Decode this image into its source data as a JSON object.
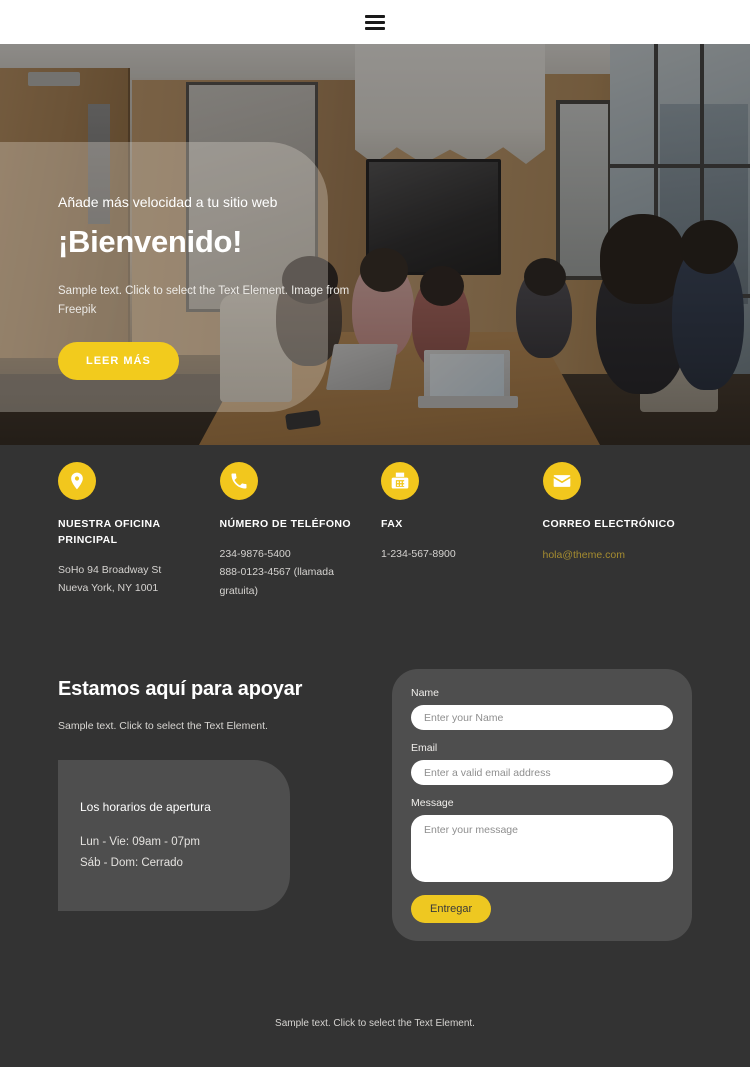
{
  "header": {
    "menu_icon": "hamburger-icon"
  },
  "hero": {
    "kicker": "Añade más velocidad a tu sitio web",
    "title": "¡Bienvenido!",
    "subtitle": "Sample text. Click to select the Text Element. Image from Freepik",
    "cta_label": "LEER MÁS",
    "accent_color": "#f2cb1d"
  },
  "contact": {
    "items": [
      {
        "icon": "location-pin-icon",
        "title": "NUESTRA OFICINA PRINCIPAL",
        "lines": [
          "SoHo 94 Broadway St",
          "Nueva York, NY 1001"
        ],
        "link": ""
      },
      {
        "icon": "phone-icon",
        "title": "NÚMERO DE TELÉFONO",
        "lines": [
          "234-9876-5400",
          "888-0123-4567 (llamada gratuita)"
        ],
        "link": ""
      },
      {
        "icon": "fax-icon",
        "title": "FAX",
        "lines": [
          "1-234-567-8900"
        ],
        "link": ""
      },
      {
        "icon": "envelope-icon",
        "title": "CORREO ELECTRÓNICO",
        "lines": [],
        "link": "hola@theme.com"
      }
    ],
    "icon_bg_color": "#f2c71d",
    "link_color": "#a58c30"
  },
  "support": {
    "heading": "Estamos aquí para apoyar",
    "paragraph": "Sample text. Click to select the Text Element.",
    "hours": {
      "title": "Los horarios de apertura",
      "weekday": "Lun - Vie: 09am - 07pm",
      "weekend": "Sáb - Dom: Cerrado"
    }
  },
  "form": {
    "name_label": "Name",
    "name_placeholder": "Enter your Name",
    "email_label": "Email",
    "email_placeholder": "Enter a valid email address",
    "message_label": "Message",
    "message_placeholder": "Enter your message",
    "submit_label": "Entregar",
    "submit_color": "#eec821"
  },
  "footer": {
    "text": "Sample text. Click to select the Text Element."
  }
}
